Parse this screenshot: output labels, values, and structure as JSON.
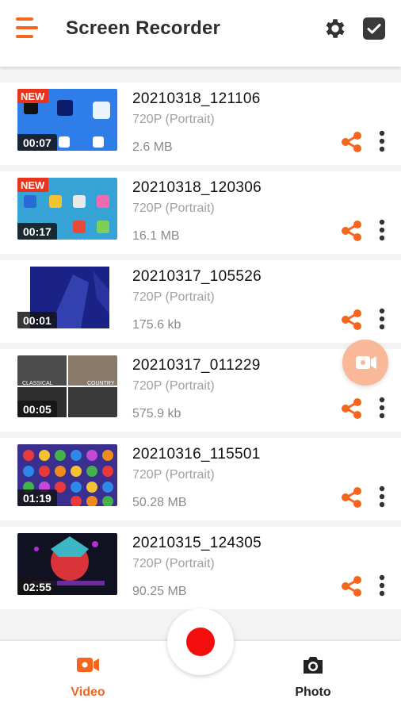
{
  "app": {
    "title": "Screen Recorder",
    "accent_color": "#f5651f",
    "icons": [
      "menu-icon",
      "gear-icon",
      "check-icon",
      "share-icon",
      "more-vert-icon",
      "video-camera-icon",
      "camera-icon"
    ]
  },
  "recordings": [
    {
      "name": "20210318_121106",
      "resolution": "720P (Portrait)",
      "size": "2.6 MB",
      "duration": "00:07",
      "is_new": true,
      "new_label": "NEW"
    },
    {
      "name": "20210318_120306",
      "resolution": "720P (Portrait)",
      "size": "16.1 MB",
      "duration": "00:17",
      "is_new": true,
      "new_label": "NEW"
    },
    {
      "name": "20210317_105526",
      "resolution": "720P (Portrait)",
      "size": "175.6 kb",
      "duration": "00:01",
      "is_new": false
    },
    {
      "name": "20210317_011229",
      "resolution": "720P (Portrait)",
      "size": "575.9 kb",
      "duration": "00:05",
      "is_new": false
    },
    {
      "name": "20210316_115501",
      "resolution": "720P (Portrait)",
      "size": "50.28 MB",
      "duration": "01:19",
      "is_new": false
    },
    {
      "name": "20210315_124305",
      "resolution": "720P (Portrait)",
      "size": "90.25 MB",
      "duration": "02:55",
      "is_new": false
    }
  ],
  "bottom_nav": {
    "video_label": "Video",
    "photo_label": "Photo",
    "active": "Video"
  }
}
